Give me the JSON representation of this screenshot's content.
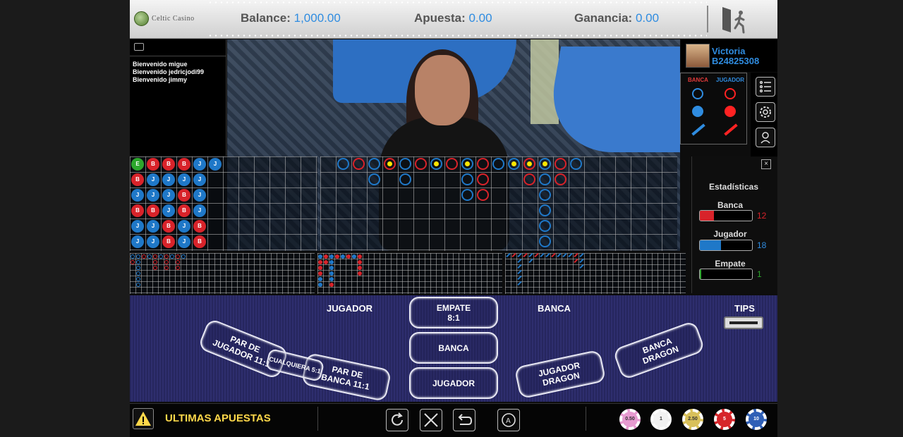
{
  "header": {
    "logo_text": "Celtic Casino",
    "balance_label": "Balance:",
    "balance_value": "1,000.00",
    "bet_label": "Apuesta:",
    "bet_value": "0.00",
    "win_label": "Ganancia:",
    "win_value": "0.00"
  },
  "chat": {
    "messages": [
      "Bienvenido migue",
      "Bienvenido jedricjodi99",
      "Bienvenido jimmy"
    ]
  },
  "player": {
    "name": "Victoria",
    "id": "B24825308"
  },
  "scoreboard": {
    "banca_label": "BANCA",
    "jugador_label": "JUGADOR"
  },
  "bead_road": [
    [
      "E",
      "B",
      "B",
      "B",
      "J",
      "J"
    ],
    [
      "B",
      "J",
      "J",
      "J",
      "J"
    ],
    [
      "J",
      "J",
      "J",
      "B",
      "J"
    ],
    [
      "B",
      "B",
      "J",
      "B",
      "J"
    ],
    [
      "J",
      "J",
      "B",
      "J",
      "B"
    ],
    [
      "J",
      "J",
      "B",
      "J",
      "B"
    ]
  ],
  "stats": {
    "title": "Estadísticas",
    "banca_label": "Banca",
    "banca_value": "12",
    "banca_fraction": 0.27,
    "jugador_label": "Jugador",
    "jugador_value": "18",
    "jugador_fraction": 0.41,
    "empate_label": "Empate",
    "empate_value": "1",
    "empate_fraction": 0.03
  },
  "betting": {
    "jugador_header": "JUGADOR",
    "banca_header": "BANCA",
    "tips_label": "TIPS",
    "empate": "EMPATE\n8:1",
    "banca": "BANCA",
    "jugador": "JUGADOR",
    "par_jugador": "PAR DE\nJUGADOR 11:1",
    "cualquiera": "CUALQUIERA 5:1",
    "par_banca": "PAR DE\nBANCA 11:1",
    "jugador_dragon": "JUGADOR\nDRAGON",
    "banca_dragon": "BANCA\nDRAGON"
  },
  "bottom": {
    "last_bets_label": "ULTIMAS APUESTAS",
    "chips": [
      {
        "label": "0.50",
        "color": "#e79ad0"
      },
      {
        "label": "1",
        "color": "#f2f2f2"
      },
      {
        "label": "2.50",
        "color": "#d8c05a"
      },
      {
        "label": "5",
        "color": "#d6252a"
      },
      {
        "label": "10",
        "color": "#2f5fb6"
      }
    ]
  },
  "colors": {
    "banker": "#d8232a",
    "player": "#1f78c8",
    "tie": "#2ca62c",
    "accent_blue": "#2f8ce0",
    "warning_yellow": "#ffd84a"
  }
}
